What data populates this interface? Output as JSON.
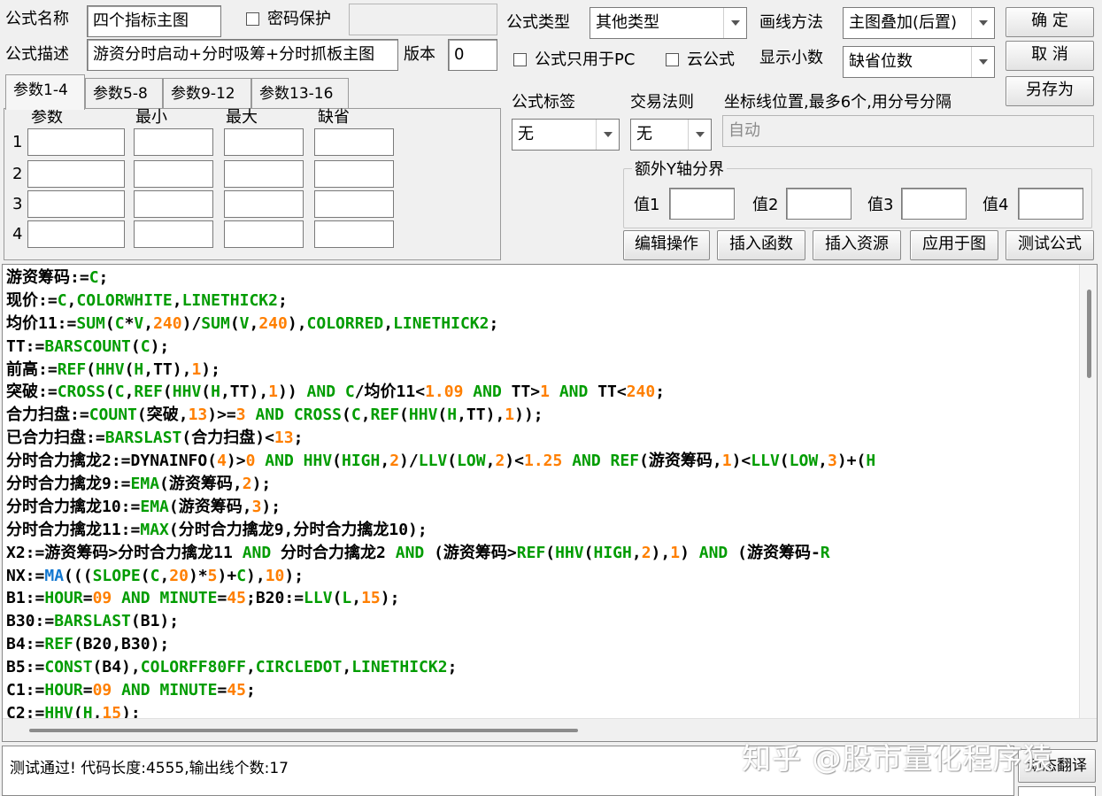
{
  "formula": {
    "name_label": "公式名称",
    "name_value": "四个指标主图",
    "password_label": "密码保护",
    "password_value": "",
    "desc_label": "公式描述",
    "desc_value": "游资分时启动+分时吸筹+分时抓板主图",
    "version_label": "版本",
    "version_value": "0",
    "type_label": "公式类型",
    "type_value": "其他类型",
    "draw_label": "画线方法",
    "draw_value": "主图叠加(后置)",
    "pc_only_label": "公式只用于PC",
    "cloud_label": "云公式",
    "decimal_label": "显示小数",
    "decimal_value": "缺省位数"
  },
  "buttons": {
    "ok": "确 定",
    "cancel": "取 消",
    "save_as": "另存为",
    "edit_ops": "编辑操作",
    "insert_func": "插入函数",
    "insert_res": "插入资源",
    "apply": "应用于图",
    "test": "测试公式",
    "dynamic_translate": "动态翻译"
  },
  "params": {
    "tabs": [
      "参数1-4",
      "参数5-8",
      "参数9-12",
      "参数13-16"
    ],
    "headers": [
      "参数",
      "最小",
      "最大",
      "缺省"
    ],
    "rows": [
      "1",
      "2",
      "3",
      "4"
    ]
  },
  "tag": {
    "label": "公式标签",
    "value": "无"
  },
  "rule": {
    "label": "交易法则",
    "value": "无"
  },
  "axis": {
    "label": "坐标线位置,最多6个,用分号分隔",
    "value": "自动"
  },
  "yaxis": {
    "title": "额外Y轴分界",
    "labels": [
      "值1",
      "值2",
      "值3",
      "值4"
    ]
  },
  "code_lines": [
    [
      [
        "游资筹码:=",
        "plain"
      ],
      [
        "C",
        "kw"
      ],
      [
        ";",
        "plain"
      ]
    ],
    [
      [
        "现价:=",
        "plain"
      ],
      [
        "C",
        "kw"
      ],
      [
        ",",
        "plain"
      ],
      [
        "COLORWHITE",
        "kw"
      ],
      [
        ",",
        "plain"
      ],
      [
        "LINETHICK2",
        "kw"
      ],
      [
        ";",
        "plain"
      ]
    ],
    [
      [
        "均价11:=",
        "plain"
      ],
      [
        "SUM",
        "kw"
      ],
      [
        "(",
        "plain"
      ],
      [
        "C",
        "kw"
      ],
      [
        "*",
        "plain"
      ],
      [
        "V",
        "kw"
      ],
      [
        ",",
        "plain"
      ],
      [
        "240",
        "num"
      ],
      [
        ")/",
        "plain"
      ],
      [
        "SUM",
        "kw"
      ],
      [
        "(",
        "plain"
      ],
      [
        "V",
        "kw"
      ],
      [
        ",",
        "plain"
      ],
      [
        "240",
        "num"
      ],
      [
        "),",
        "plain"
      ],
      [
        "COLORRED",
        "kw"
      ],
      [
        ",",
        "plain"
      ],
      [
        "LINETHICK2",
        "kw"
      ],
      [
        ";",
        "plain"
      ]
    ],
    [
      [
        "TT:=",
        "plain"
      ],
      [
        "BARSCOUNT",
        "kw"
      ],
      [
        "(",
        "plain"
      ],
      [
        "C",
        "kw"
      ],
      [
        ");",
        "plain"
      ]
    ],
    [
      [
        "前高:=",
        "plain"
      ],
      [
        "REF",
        "kw"
      ],
      [
        "(",
        "plain"
      ],
      [
        "HHV",
        "kw"
      ],
      [
        "(",
        "plain"
      ],
      [
        "H",
        "kw"
      ],
      [
        ",TT),",
        "plain"
      ],
      [
        "1",
        "num"
      ],
      [
        ");",
        "plain"
      ]
    ],
    [
      [
        "突破:=",
        "plain"
      ],
      [
        "CROSS",
        "kw"
      ],
      [
        "(",
        "plain"
      ],
      [
        "C",
        "kw"
      ],
      [
        ",",
        "plain"
      ],
      [
        "REF",
        "kw"
      ],
      [
        "(",
        "plain"
      ],
      [
        "HHV",
        "kw"
      ],
      [
        "(",
        "plain"
      ],
      [
        "H",
        "kw"
      ],
      [
        ",TT),",
        "plain"
      ],
      [
        "1",
        "num"
      ],
      [
        ")) ",
        "plain"
      ],
      [
        "AND",
        "kw"
      ],
      [
        " ",
        "plain"
      ],
      [
        "C",
        "kw"
      ],
      [
        "/均价11<",
        "plain"
      ],
      [
        "1.09",
        "num"
      ],
      [
        " ",
        "plain"
      ],
      [
        "AND",
        "kw"
      ],
      [
        " TT>",
        "plain"
      ],
      [
        "1",
        "num"
      ],
      [
        " ",
        "plain"
      ],
      [
        "AND",
        "kw"
      ],
      [
        " TT<",
        "plain"
      ],
      [
        "240",
        "num"
      ],
      [
        ";",
        "plain"
      ]
    ],
    [
      [
        "合力扫盘:=",
        "plain"
      ],
      [
        "COUNT",
        "kw"
      ],
      [
        "(突破,",
        "plain"
      ],
      [
        "13",
        "num"
      ],
      [
        ")>=",
        "plain"
      ],
      [
        "3",
        "num"
      ],
      [
        " ",
        "plain"
      ],
      [
        "AND",
        "kw"
      ],
      [
        " ",
        "plain"
      ],
      [
        "CROSS",
        "kw"
      ],
      [
        "(",
        "plain"
      ],
      [
        "C",
        "kw"
      ],
      [
        ",",
        "plain"
      ],
      [
        "REF",
        "kw"
      ],
      [
        "(",
        "plain"
      ],
      [
        "HHV",
        "kw"
      ],
      [
        "(",
        "plain"
      ],
      [
        "H",
        "kw"
      ],
      [
        ",TT),",
        "plain"
      ],
      [
        "1",
        "num"
      ],
      [
        "));",
        "plain"
      ]
    ],
    [
      [
        "已合力扫盘:=",
        "plain"
      ],
      [
        "BARSLAST",
        "kw"
      ],
      [
        "(合力扫盘)<",
        "plain"
      ],
      [
        "13",
        "num"
      ],
      [
        ";",
        "plain"
      ]
    ],
    [
      [
        "分时合力擒龙2:=",
        "plain"
      ],
      [
        "DYNAINFO",
        "plain"
      ],
      [
        "(",
        "plain"
      ],
      [
        "4",
        "num"
      ],
      [
        ")>",
        "plain"
      ],
      [
        "0",
        "num"
      ],
      [
        " ",
        "plain"
      ],
      [
        "AND",
        "kw"
      ],
      [
        " ",
        "plain"
      ],
      [
        "HHV",
        "kw"
      ],
      [
        "(",
        "plain"
      ],
      [
        "HIGH",
        "kw"
      ],
      [
        ",",
        "plain"
      ],
      [
        "2",
        "num"
      ],
      [
        ")/",
        "plain"
      ],
      [
        "LLV",
        "kw"
      ],
      [
        "(",
        "plain"
      ],
      [
        "LOW",
        "kw"
      ],
      [
        ",",
        "plain"
      ],
      [
        "2",
        "num"
      ],
      [
        ")<",
        "plain"
      ],
      [
        "1.25",
        "num"
      ],
      [
        " ",
        "plain"
      ],
      [
        "AND",
        "kw"
      ],
      [
        " ",
        "plain"
      ],
      [
        "REF",
        "kw"
      ],
      [
        "(游资筹码,",
        "plain"
      ],
      [
        "1",
        "num"
      ],
      [
        ")<",
        "plain"
      ],
      [
        "LLV",
        "kw"
      ],
      [
        "(",
        "plain"
      ],
      [
        "LOW",
        "kw"
      ],
      [
        ",",
        "plain"
      ],
      [
        "3",
        "num"
      ],
      [
        ")+(",
        "plain"
      ],
      [
        "H",
        "kw"
      ]
    ],
    [
      [
        "分时合力擒龙9:=",
        "plain"
      ],
      [
        "EMA",
        "kw"
      ],
      [
        "(游资筹码,",
        "plain"
      ],
      [
        "2",
        "num"
      ],
      [
        ");",
        "plain"
      ]
    ],
    [
      [
        "分时合力擒龙10:=",
        "plain"
      ],
      [
        "EMA",
        "kw"
      ],
      [
        "(游资筹码,",
        "plain"
      ],
      [
        "3",
        "num"
      ],
      [
        ");",
        "plain"
      ]
    ],
    [
      [
        "分时合力擒龙11:=",
        "plain"
      ],
      [
        "MAX",
        "kw"
      ],
      [
        "(分时合力擒龙9,分时合力擒龙10);",
        "plain"
      ]
    ],
    [
      [
        "X2:=游资筹码>分时合力擒龙11 ",
        "plain"
      ],
      [
        "AND",
        "kw"
      ],
      [
        " 分时合力擒龙2 ",
        "plain"
      ],
      [
        "AND",
        "kw"
      ],
      [
        " (游资筹码>",
        "plain"
      ],
      [
        "REF",
        "kw"
      ],
      [
        "(",
        "plain"
      ],
      [
        "HHV",
        "kw"
      ],
      [
        "(",
        "plain"
      ],
      [
        "HIGH",
        "kw"
      ],
      [
        ",",
        "plain"
      ],
      [
        "2",
        "num"
      ],
      [
        "),",
        "plain"
      ],
      [
        "1",
        "num"
      ],
      [
        ") ",
        "plain"
      ],
      [
        "AND",
        "kw"
      ],
      [
        " (游资筹码-",
        "plain"
      ],
      [
        "R",
        "kw"
      ]
    ],
    [
      [
        "NX:=",
        "plain"
      ],
      [
        "MA",
        "var"
      ],
      [
        "(((",
        "plain"
      ],
      [
        "SLOPE",
        "kw"
      ],
      [
        "(",
        "plain"
      ],
      [
        "C",
        "kw"
      ],
      [
        ",",
        "plain"
      ],
      [
        "20",
        "num"
      ],
      [
        ")*",
        "plain"
      ],
      [
        "5",
        "num"
      ],
      [
        ")+",
        "plain"
      ],
      [
        "C",
        "kw"
      ],
      [
        "),",
        "plain"
      ],
      [
        "10",
        "num"
      ],
      [
        ");",
        "plain"
      ]
    ],
    [
      [
        "B1:=",
        "plain"
      ],
      [
        "HOUR",
        "kw"
      ],
      [
        "=",
        "plain"
      ],
      [
        "09",
        "num"
      ],
      [
        " ",
        "plain"
      ],
      [
        "AND",
        "kw"
      ],
      [
        " ",
        "plain"
      ],
      [
        "MINUTE",
        "kw"
      ],
      [
        "=",
        "plain"
      ],
      [
        "45",
        "num"
      ],
      [
        ";B20:=",
        "plain"
      ],
      [
        "LLV",
        "kw"
      ],
      [
        "(",
        "plain"
      ],
      [
        "L",
        "kw"
      ],
      [
        ",",
        "plain"
      ],
      [
        "15",
        "num"
      ],
      [
        ");",
        "plain"
      ]
    ],
    [
      [
        "B30:=",
        "plain"
      ],
      [
        "BARSLAST",
        "kw"
      ],
      [
        "(B1);",
        "plain"
      ]
    ],
    [
      [
        "B4:=",
        "plain"
      ],
      [
        "REF",
        "kw"
      ],
      [
        "(B20,B30);",
        "plain"
      ]
    ],
    [
      [
        "B5:=",
        "plain"
      ],
      [
        "CONST",
        "kw"
      ],
      [
        "(B4),",
        "plain"
      ],
      [
        "COLORFF80FF",
        "kw"
      ],
      [
        ",",
        "plain"
      ],
      [
        "CIRCLEDOT",
        "kw"
      ],
      [
        ",",
        "plain"
      ],
      [
        "LINETHICK2",
        "kw"
      ],
      [
        ";",
        "plain"
      ]
    ],
    [
      [
        "C1:=",
        "plain"
      ],
      [
        "HOUR",
        "kw"
      ],
      [
        "=",
        "plain"
      ],
      [
        "09",
        "num"
      ],
      [
        " ",
        "plain"
      ],
      [
        "AND",
        "kw"
      ],
      [
        " ",
        "plain"
      ],
      [
        "MINUTE",
        "kw"
      ],
      [
        "=",
        "plain"
      ],
      [
        "45",
        "num"
      ],
      [
        ";",
        "plain"
      ]
    ],
    [
      [
        "C2:=",
        "plain"
      ],
      [
        "HHV",
        "kw"
      ],
      [
        "(",
        "plain"
      ],
      [
        "H",
        "kw"
      ],
      [
        ",",
        "plain"
      ],
      [
        "15",
        "num"
      ],
      [
        ");",
        "plain"
      ]
    ]
  ],
  "status_text": "测试通过! 代码长度:4555,输出线个数:17",
  "watermark": "知乎 @股市量化程序猿",
  "colors": {
    "keyword": "#009c00",
    "number": "#ff7f00",
    "variable": "#1177d0",
    "text": "#000000"
  }
}
